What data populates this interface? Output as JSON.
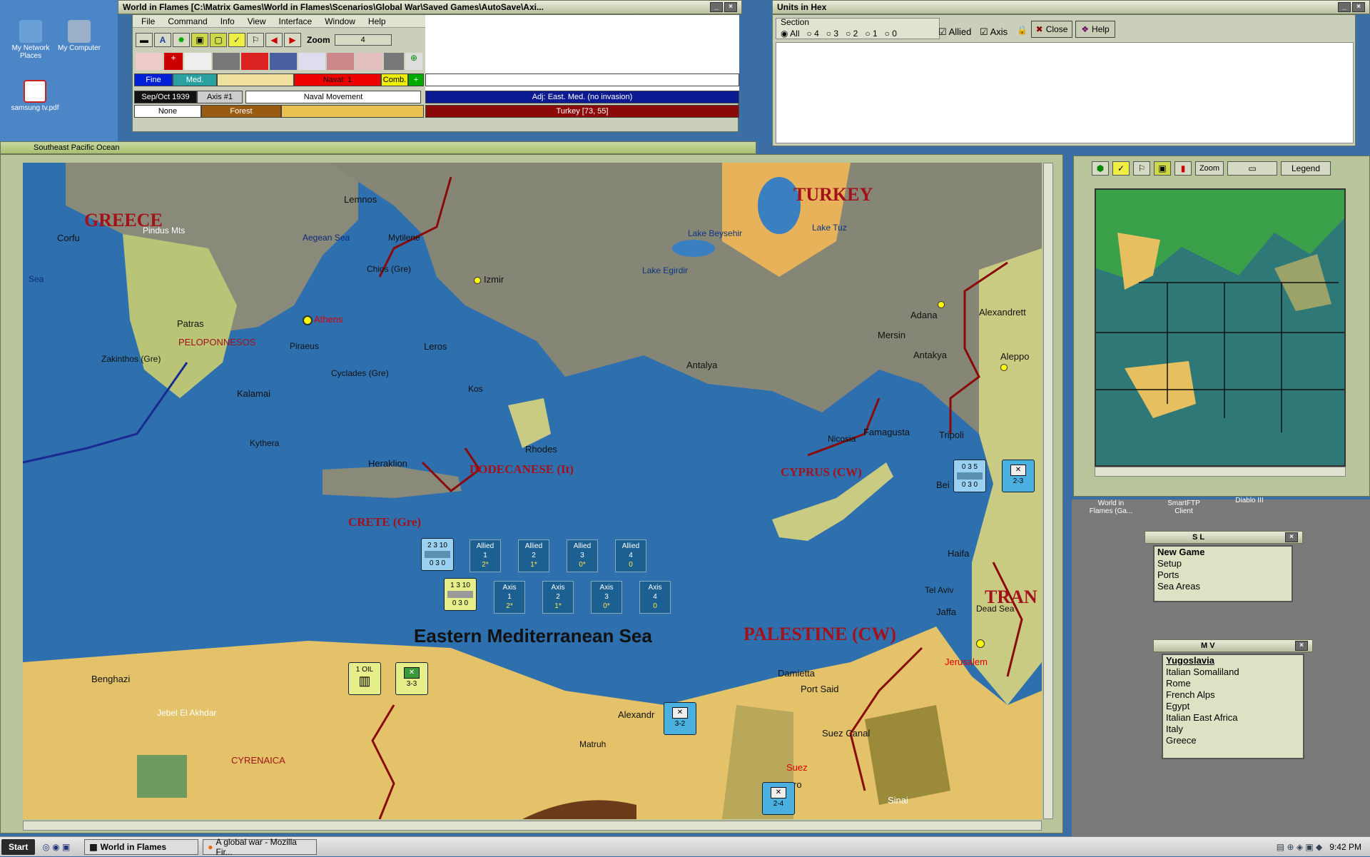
{
  "desktop": {
    "icons": [
      "My Network Places",
      "My Computer",
      "samsung tv.pdf"
    ],
    "icons2": [
      "World in Flames (Ga...",
      "SmartFTP Client",
      "Diablo III"
    ]
  },
  "main_window": {
    "title": "World in Flames [C:\\Matrix Games\\World in Flames\\Scenarios\\Global War\\Saved Games\\AutoSave\\Axi...",
    "menu": [
      "File",
      "Command",
      "Info",
      "View",
      "Interface",
      "Window",
      "Help"
    ],
    "zoom_label": "Zoom",
    "zoom_value": "4",
    "weather": "Fine",
    "weather2": "Med.",
    "naval_label": "Naval: 1",
    "comb_label": "Comb.",
    "date": "Sep/Oct 1939",
    "turn": "Axis #1",
    "phase": "Naval Movement",
    "adjacent": "Adj: East. Med. (no invasion)",
    "none_label": "None",
    "terrain": "Forest",
    "location": "Turkey [73, 55]"
  },
  "units_window": {
    "title": "Units in Hex",
    "section_label": "Section",
    "radio": [
      "All",
      "4",
      "3",
      "2",
      "1",
      "0"
    ],
    "allied_label": "Allied",
    "axis_label": "Axis",
    "close_label": "Close",
    "help_label": "Help"
  },
  "map_window": {
    "title": "Southeast Pacific Ocean"
  },
  "map": {
    "labels": [
      {
        "t": "Corfu"
      },
      {
        "t": "Pindus Mts"
      },
      {
        "t": "Lemnos"
      },
      {
        "t": "Aegean Sea"
      },
      {
        "t": "Mytilene"
      },
      {
        "t": "Chios (Gre)"
      },
      {
        "t": "Izmir"
      },
      {
        "t": "Sea"
      },
      {
        "t": "Athens"
      },
      {
        "t": "Patras"
      },
      {
        "t": "PELOPONNESOS"
      },
      {
        "t": "Piraeus"
      },
      {
        "t": "Zakinthos (Gre)"
      },
      {
        "t": "Leros"
      },
      {
        "t": "Kos"
      },
      {
        "t": "Cyclades (Gre)"
      },
      {
        "t": "Kalamai"
      },
      {
        "t": "Kythera"
      },
      {
        "t": "Rhodes"
      },
      {
        "t": "Heraklion"
      },
      {
        "t": "Lake Beysehir"
      },
      {
        "t": "Lake Tuz"
      },
      {
        "t": "Lake Egirdir"
      },
      {
        "t": "Antalya"
      },
      {
        "t": "Adana"
      },
      {
        "t": "Mersin"
      },
      {
        "t": "Alexandrett"
      },
      {
        "t": "Antakya"
      },
      {
        "t": "Aleppo"
      },
      {
        "t": "Nicosia"
      },
      {
        "t": "Famagusta"
      },
      {
        "t": "Tripoli"
      },
      {
        "t": "Bei"
      },
      {
        "t": "Haifa"
      },
      {
        "t": "Tel Aviv"
      },
      {
        "t": "Jaffa"
      },
      {
        "t": "Dead Sea"
      },
      {
        "t": "Jerusalem"
      },
      {
        "t": "Benghazi"
      },
      {
        "t": "Jebel El Akhdar"
      },
      {
        "t": "CYRENAICA"
      },
      {
        "t": "Alexandr"
      },
      {
        "t": "Matruh"
      },
      {
        "t": "Damietta"
      },
      {
        "t": "Port Said"
      },
      {
        "t": "Suez Canal"
      },
      {
        "t": "Suez"
      },
      {
        "t": "Sinai"
      },
      {
        "t": "ro"
      }
    ],
    "countries": [
      {
        "t": "GREECE"
      },
      {
        "t": "TURKEY"
      },
      {
        "t": "DODECANESE (It)"
      },
      {
        "t": "CYPRUS (CW)"
      },
      {
        "t": "CRETE (Gre)"
      },
      {
        "t": "PALESTINE (CW)"
      },
      {
        "t": "TRAN"
      }
    ],
    "sea_name": "Eastern Mediterranean Sea",
    "allied_boxes": [
      {
        "n": "1",
        "v": "2*"
      },
      {
        "n": "2",
        "v": "1*"
      },
      {
        "n": "3",
        "v": "0*"
      },
      {
        "n": "4",
        "v": "0"
      }
    ],
    "axis_boxes": [
      {
        "n": "1",
        "v": "2*"
      },
      {
        "n": "2",
        "v": "1*"
      },
      {
        "n": "3",
        "v": "0*"
      },
      {
        "n": "4",
        "v": "0"
      }
    ],
    "allied_label": "Allied",
    "axis_label": "Axis",
    "counters": {
      "oil": "1 OIL",
      "inf1": "3-3",
      "inf2": "3-2",
      "inf3": "2-4",
      "inf4": "2-3",
      "ship1": "2 3 10",
      "ship1_b": "0 3 0",
      "ship2": "1 3 10",
      "ship2_b": "0 3 0",
      "transport": "0 3 5",
      "transport_b": "0 3 0",
      "stack_top": "2",
      "stack_top2": "3"
    }
  },
  "toolbar2": {
    "zoom_label": "Zoom",
    "legend_label": "Legend"
  },
  "sl_window": {
    "title": "S L",
    "items": [
      "New Game",
      "Setup",
      "Ports",
      "Sea Areas"
    ]
  },
  "mv_window": {
    "title": "M V",
    "items": [
      "Yugoslavia",
      "Italian Somaliland",
      "Rome",
      "French Alps",
      "Egypt",
      "Italian East Africa",
      "Italy",
      "Greece"
    ]
  },
  "taskbar": {
    "start": "Start",
    "tasks": [
      "World in Flames",
      "A global war - Mozilla Fir..."
    ],
    "clock": "9:42 PM"
  }
}
